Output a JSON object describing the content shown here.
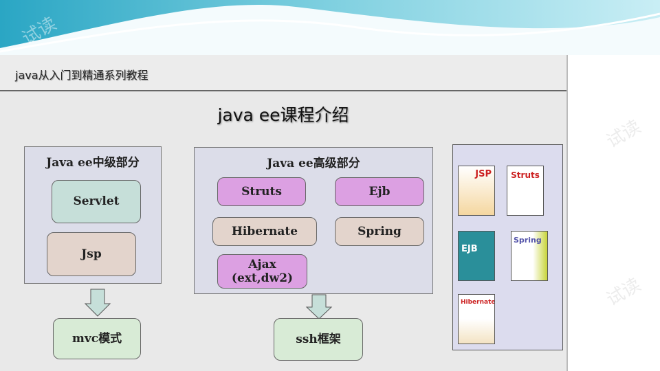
{
  "header": {
    "series_title": "java从入门到精通系列教程"
  },
  "slide": {
    "title": "java ee课程介绍"
  },
  "intermediate": {
    "title": "Java ee中级部分",
    "items": [
      "Servlet",
      "Jsp"
    ],
    "result": "mvc模式"
  },
  "advanced": {
    "title": "Java ee高级部分",
    "items": [
      "Struts",
      "Ejb",
      "Hibernate",
      "Spring",
      "Ajax\n(ext,dw2)"
    ],
    "result": "ssh框架"
  },
  "books": {
    "covers": [
      "JSP",
      "Struts",
      "EJB",
      "Spring",
      "Hibernate"
    ]
  },
  "watermark": "试读",
  "colors": {
    "banner": "#3fb3c9",
    "purple": "#dca0e2",
    "teal": "#c6dfd9",
    "tan": "#e3d4cc",
    "panel": "#dcdde9"
  }
}
